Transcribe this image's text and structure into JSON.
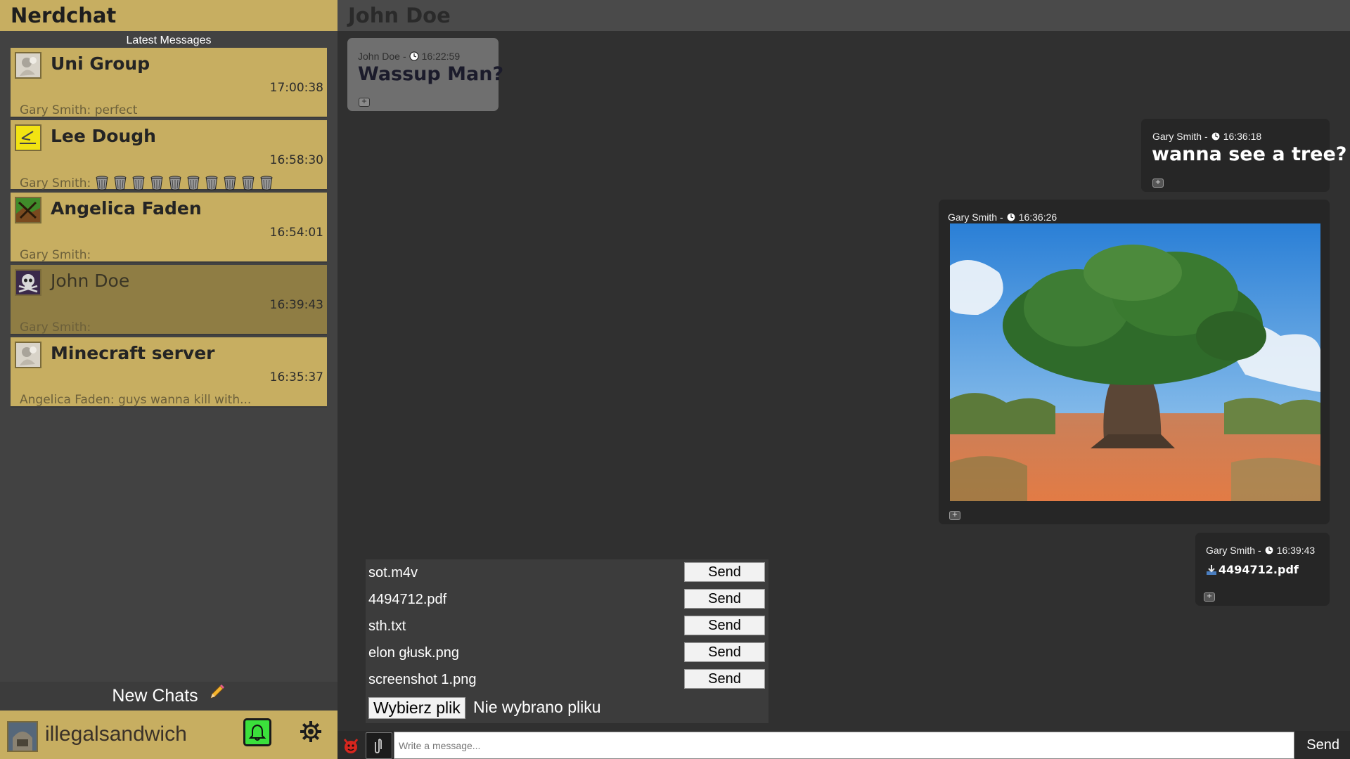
{
  "app": {
    "title": "Nerdchat"
  },
  "sidebar": {
    "section_label": "Latest Messages",
    "chats": [
      {
        "name": "Uni Group",
        "time": "17:00:38",
        "preview": "Gary Smith: perfect",
        "avatar_icon": "group-avatar-icon",
        "active": false
      },
      {
        "name": "Lee Dough",
        "time": "16:58:30",
        "preview": "Gary Smith:",
        "preview_icons": [
          "trash-can-icon",
          "trash-can-icon",
          "trash-can-icon",
          "trash-can-icon",
          "trash-can-icon",
          "trash-can-icon",
          "trash-can-icon",
          "trash-can-icon",
          "trash-can-icon",
          "trash-can-icon"
        ],
        "avatar_icon": "sticky-note-avatar-icon",
        "active": false
      },
      {
        "name": "Angelica Faden",
        "time": "16:54:01",
        "preview": "Gary Smith:",
        "avatar_icon": "landscape-avatar-icon",
        "active": false
      },
      {
        "name": "John Doe",
        "time": "16:39:43",
        "preview": "Gary Smith:",
        "avatar_icon": "skull-avatar-icon",
        "active": true
      },
      {
        "name": "Minecraft server",
        "time": "16:35:37",
        "preview": "Angelica Faden: guys wanna kill with...",
        "avatar_icon": "group-avatar-icon",
        "active": false
      }
    ],
    "new_chats_label": "New Chats",
    "new_chats_icon": "pencil-icon",
    "user": {
      "username": "illegalsandwich",
      "bell_icon": "bell-icon",
      "settings_icon": "gear-icon"
    }
  },
  "chat": {
    "title": "John Doe",
    "messages": [
      {
        "author": "John Doe",
        "separator": "-",
        "time": "16:22:59",
        "text": "Wassup Man?",
        "direction": "incoming"
      },
      {
        "author": "Gary Smith",
        "separator": "-",
        "time": "16:36:18",
        "text": "wanna see a tree?",
        "direction": "outgoing"
      },
      {
        "author": "Gary Smith",
        "separator": "-",
        "time": "16:36:26",
        "image": "baobab-tree-photo",
        "direction": "outgoing"
      },
      {
        "author": "Gary Smith",
        "separator": "-",
        "time": "16:39:43",
        "file": "4494712.pdf",
        "direction": "outgoing"
      }
    ]
  },
  "file_queue": {
    "files": [
      {
        "name": "sot.m4v",
        "send_label": "Send"
      },
      {
        "name": "4494712.pdf",
        "send_label": "Send"
      },
      {
        "name": "sth.txt",
        "send_label": "Send"
      },
      {
        "name": "elon głusk.png",
        "send_label": "Send"
      },
      {
        "name": "screenshot 1.png",
        "send_label": "Send"
      }
    ],
    "choose_file_label": "Wybierz plik",
    "no_file_label": "Nie wybrano pliku"
  },
  "composer": {
    "placeholder": "Write a message...",
    "send_label": "Send",
    "emoji_icon": "devil-emoji-icon",
    "attach_icon": "paperclip-icon"
  },
  "colors": {
    "accent": "#c7ae61",
    "active_chat": "#8f7d44",
    "bell_green": "#3be03b",
    "background": "#303030"
  }
}
